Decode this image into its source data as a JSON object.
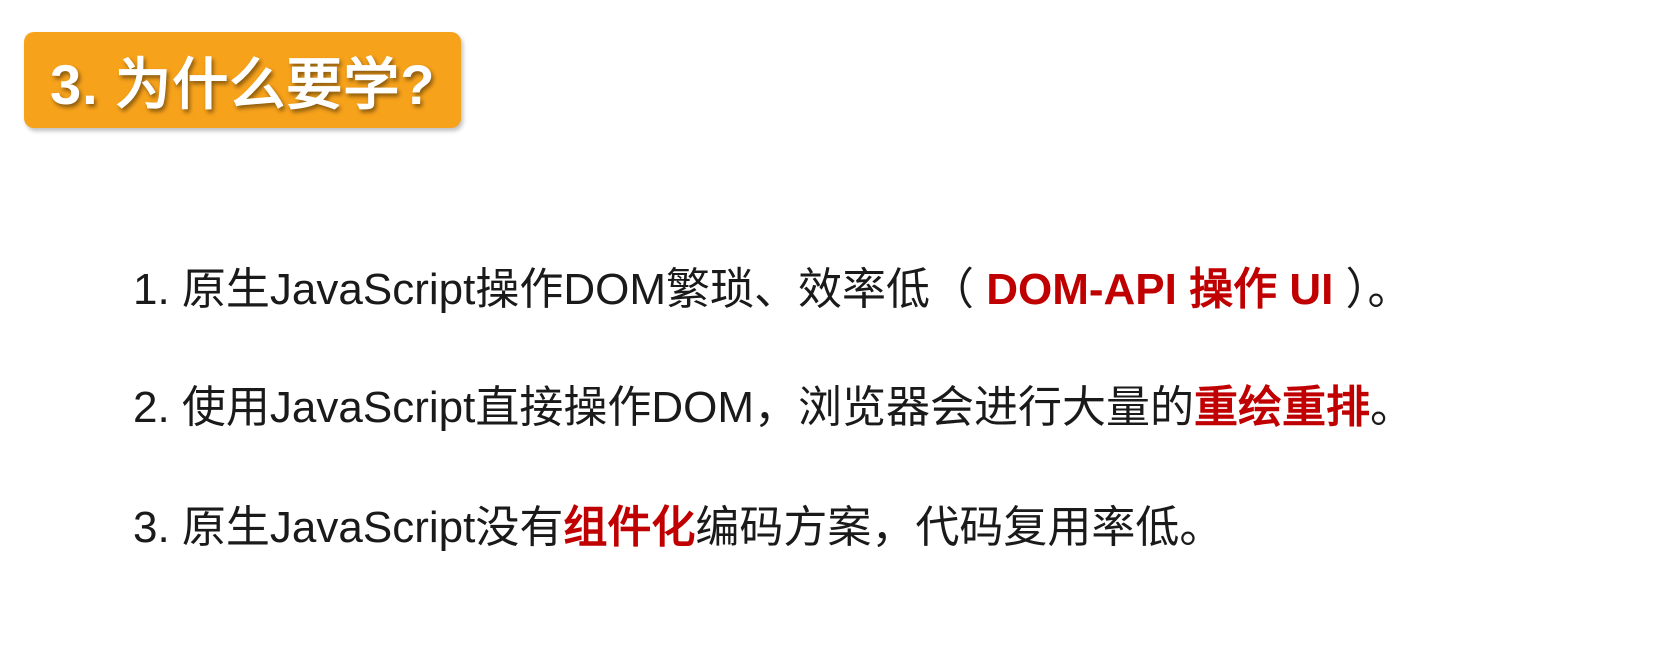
{
  "title": "3. 为什么要学?",
  "points": [
    {
      "before": "1. 原生JavaScript操作DOM繁琐、效率低（ ",
      "highlight": "DOM-API 操作 UI",
      "after": " ）。"
    },
    {
      "before": "2. 使用JavaScript直接操作DOM，浏览器会进行大量的",
      "highlight": "重绘重排",
      "after": "。"
    },
    {
      "before": "3. 原生JavaScript没有",
      "highlight": "组件化",
      "after": "编码方案，代码复用率低。"
    }
  ],
  "colors": {
    "title_bg": "#f7a21b",
    "title_text": "#ffffff",
    "body_text": "#1a1a1a",
    "highlight": "#c00000"
  }
}
